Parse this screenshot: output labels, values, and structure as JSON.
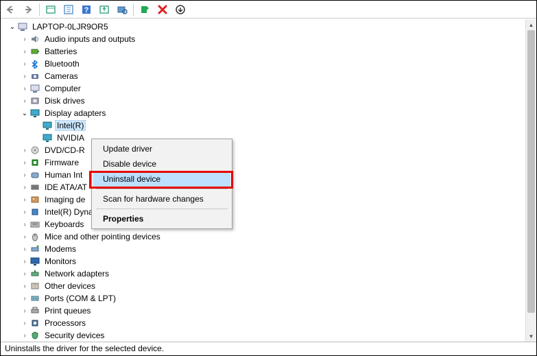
{
  "toolbar": {
    "icons": [
      "back",
      "forward",
      "sep",
      "view",
      "details",
      "help",
      "update",
      "scan",
      "sep",
      "add",
      "remove",
      "more"
    ]
  },
  "root": {
    "label": "LAPTOP-0LJR9OR5",
    "expanded": true
  },
  "categories": [
    {
      "label": "Audio inputs and outputs",
      "icon": "audio",
      "expanded": false
    },
    {
      "label": "Batteries",
      "icon": "battery",
      "expanded": false
    },
    {
      "label": "Bluetooth",
      "icon": "bluetooth",
      "expanded": false
    },
    {
      "label": "Cameras",
      "icon": "camera",
      "expanded": false
    },
    {
      "label": "Computer",
      "icon": "computer",
      "expanded": false
    },
    {
      "label": "Disk drives",
      "icon": "disk",
      "expanded": false
    },
    {
      "label": "Display adapters",
      "icon": "display",
      "expanded": true,
      "children": [
        {
          "label": "Intel(R)",
          "icon": "display",
          "selected": true,
          "truncated": true
        },
        {
          "label": "NVIDIA",
          "icon": "display",
          "truncated": true
        }
      ]
    },
    {
      "label": "DVD/CD-R",
      "icon": "dvd",
      "expanded": false,
      "truncated": true
    },
    {
      "label": "Firmware",
      "icon": "firmware",
      "expanded": false
    },
    {
      "label": "Human Int",
      "icon": "hid",
      "expanded": false,
      "truncated": true
    },
    {
      "label": "IDE ATA/AT",
      "icon": "ide",
      "expanded": false,
      "truncated": true
    },
    {
      "label": "Imaging de",
      "icon": "imaging",
      "expanded": false,
      "truncated": true
    },
    {
      "label": "Intel(R) Dynamic Platform and Thermal Framework",
      "icon": "thermal",
      "expanded": false
    },
    {
      "label": "Keyboards",
      "icon": "keyboard",
      "expanded": false
    },
    {
      "label": "Mice and other pointing devices",
      "icon": "mouse",
      "expanded": false
    },
    {
      "label": "Modems",
      "icon": "modem",
      "expanded": false
    },
    {
      "label": "Monitors",
      "icon": "monitor",
      "expanded": false
    },
    {
      "label": "Network adapters",
      "icon": "network",
      "expanded": false
    },
    {
      "label": "Other devices",
      "icon": "other",
      "expanded": false
    },
    {
      "label": "Ports (COM & LPT)",
      "icon": "port",
      "expanded": false
    },
    {
      "label": "Print queues",
      "icon": "printer",
      "expanded": false
    },
    {
      "label": "Processors",
      "icon": "cpu",
      "expanded": false
    },
    {
      "label": "Security devices",
      "icon": "security",
      "expanded": false,
      "clipped": true
    }
  ],
  "context_menu": {
    "items": [
      {
        "label": "Update driver"
      },
      {
        "label": "Disable device"
      },
      {
        "label": "Uninstall device",
        "hover": true,
        "highlighted": true
      },
      {
        "sep": true
      },
      {
        "label": "Scan for hardware changes"
      },
      {
        "sep": true
      },
      {
        "label": "Properties",
        "bold": true
      }
    ]
  },
  "status": {
    "text": "Uninstalls the driver for the selected device."
  },
  "colors": {
    "highlight_border": "#e60000",
    "hover_bg": "#bde0ff",
    "selection_bg": "#cce8ff"
  }
}
